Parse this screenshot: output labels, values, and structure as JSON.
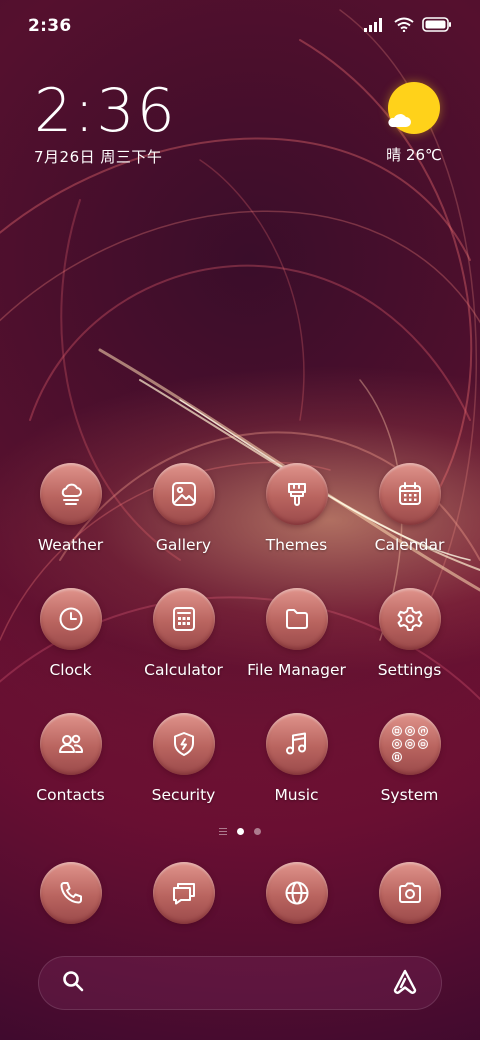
{
  "status_bar": {
    "time": "2:36",
    "icons": [
      "signal-icon",
      "wifi-icon",
      "battery-icon"
    ]
  },
  "clock_widget": {
    "time": "2:36",
    "date": "7月26日 周三下午"
  },
  "weather_widget": {
    "icon": "sunny-partly-cloudy-icon",
    "text": "晴 26℃",
    "sun_color": "#ffd21a"
  },
  "apps": [
    [
      {
        "label": "Weather",
        "icon": "weather-icon"
      },
      {
        "label": "Gallery",
        "icon": "gallery-icon"
      },
      {
        "label": "Themes",
        "icon": "themes-icon"
      },
      {
        "label": "Calendar",
        "icon": "calendar-icon"
      }
    ],
    [
      {
        "label": "Clock",
        "icon": "clock-icon"
      },
      {
        "label": "Calculator",
        "icon": "calculator-icon"
      },
      {
        "label": "File Manager",
        "icon": "folder-icon"
      },
      {
        "label": "Settings",
        "icon": "gear-icon"
      }
    ],
    [
      {
        "label": "Contacts",
        "icon": "contacts-icon"
      },
      {
        "label": "Security",
        "icon": "shield-icon"
      },
      {
        "label": "Music",
        "icon": "music-icon"
      },
      {
        "label": "System",
        "icon": "folder-grid-icon"
      }
    ]
  ],
  "page_indicator": {
    "pages": 2,
    "active_page": 1
  },
  "dock": [
    {
      "icon": "phone-icon"
    },
    {
      "icon": "messages-icon"
    },
    {
      "icon": "browser-icon"
    },
    {
      "icon": "camera-icon"
    }
  ],
  "search_bar": {
    "left_icon": "search-icon",
    "right_icon": "assistant-icon"
  },
  "colors": {
    "icon_bg": "#b9645f",
    "background": "#8e1640"
  }
}
